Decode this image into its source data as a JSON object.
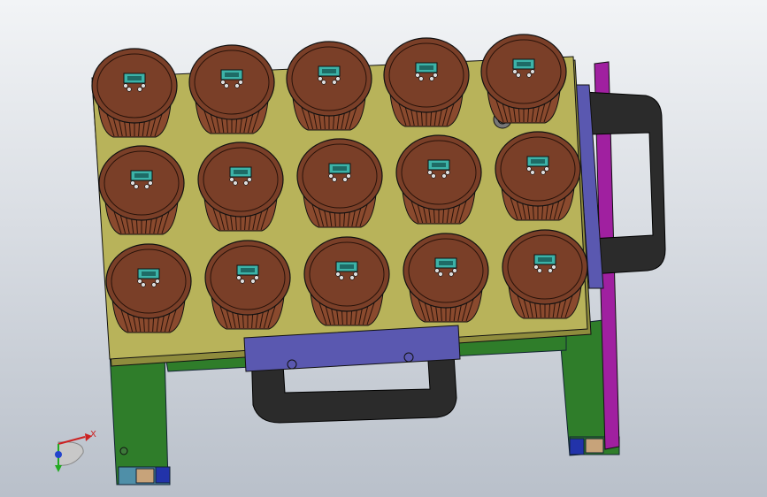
{
  "viewport": {
    "background_top": "#f2f4f6",
    "background_bottom": "#b9c0ca"
  },
  "model": {
    "plate_color": "#b8b35a",
    "frame_color": "#2f7d2a",
    "handle_color": "#2b2b2b",
    "handle_bracket_color": "#5a58b0",
    "rail_color": "#a020a0",
    "cup_color": "#7a3f28",
    "connector_color": "#3cb3a8",
    "cup_rows": 3,
    "cup_columns": 5
  },
  "triad": {
    "x_label": "X",
    "x_color": "#cc2222",
    "y_color": "#22aa22",
    "z_color": "#2244cc"
  }
}
